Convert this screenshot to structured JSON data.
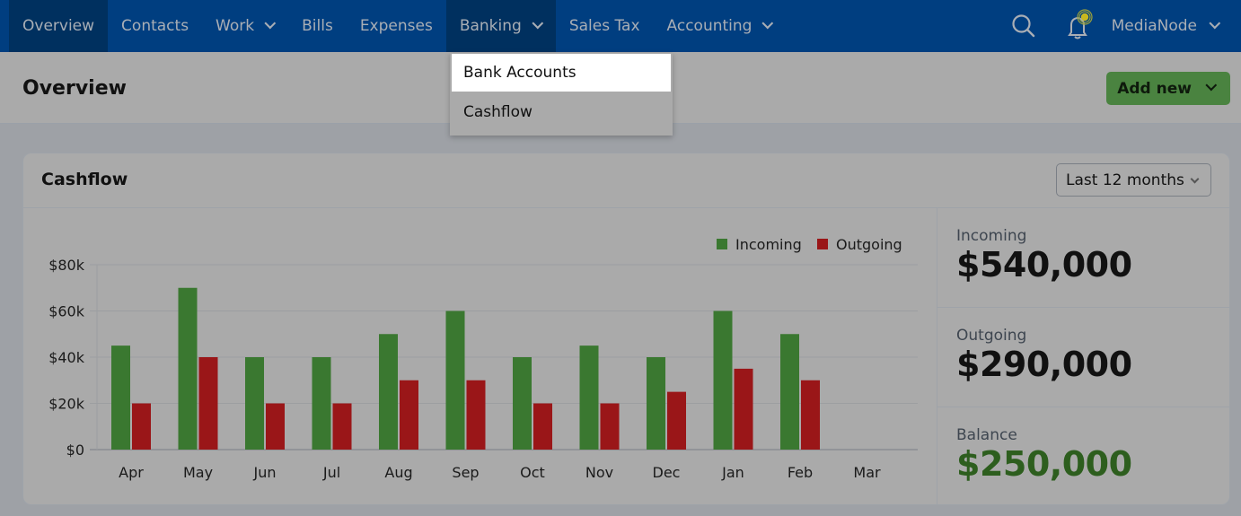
{
  "nav": {
    "items": [
      {
        "label": "Overview",
        "active": true,
        "has_dropdown": false
      },
      {
        "label": "Contacts",
        "active": false,
        "has_dropdown": false
      },
      {
        "label": "Work",
        "active": false,
        "has_dropdown": true
      },
      {
        "label": "Bills",
        "active": false,
        "has_dropdown": false
      },
      {
        "label": "Expenses",
        "active": false,
        "has_dropdown": false
      },
      {
        "label": "Banking",
        "active": true,
        "has_dropdown": true
      },
      {
        "label": "Sales Tax",
        "active": false,
        "has_dropdown": false
      },
      {
        "label": "Accounting",
        "active": false,
        "has_dropdown": true
      }
    ],
    "search_icon": "search-icon",
    "notification_icon": "bell-icon",
    "user_label": "MediaNode"
  },
  "banking_menu": {
    "items": [
      {
        "label": "Bank Accounts",
        "highlighted": true
      },
      {
        "label": "Cashflow",
        "highlighted": false
      }
    ]
  },
  "header": {
    "title": "Overview",
    "add_new_label": "Add new"
  },
  "cashflow": {
    "title": "Cashflow",
    "period_selected": "Last 12 months",
    "stats": [
      {
        "label": "Incoming",
        "value": "$540,000"
      },
      {
        "label": "Outgoing",
        "value": "$290,000"
      },
      {
        "label": "Balance",
        "value": "$250,000"
      }
    ]
  },
  "colors": {
    "nav_bg": "#003e80",
    "incoming": "#3a7830",
    "outgoing": "#9a1618",
    "balance": "#2d5e1e",
    "add_button": "#4a8340"
  },
  "chart_data": {
    "type": "bar",
    "title": "Cashflow",
    "categories": [
      "Apr",
      "May",
      "Jun",
      "Jul",
      "Aug",
      "Sep",
      "Oct",
      "Nov",
      "Dec",
      "Jan",
      "Feb",
      "Mar"
    ],
    "series": [
      {
        "name": "Incoming",
        "values": [
          45000,
          70000,
          40000,
          40000,
          50000,
          60000,
          40000,
          45000,
          40000,
          60000,
          50000,
          0
        ]
      },
      {
        "name": "Outgoing",
        "values": [
          20000,
          40000,
          20000,
          20000,
          30000,
          30000,
          20000,
          20000,
          25000,
          35000,
          30000,
          0
        ]
      }
    ],
    "yticks": [
      0,
      20000,
      40000,
      60000,
      80000
    ],
    "ytick_labels": [
      "$0",
      "$20k",
      "$40k",
      "$60k",
      "$80k"
    ],
    "ylim": [
      0,
      80000
    ],
    "xlabel": "",
    "ylabel": "",
    "grid": true,
    "legend_position": "top-right"
  }
}
